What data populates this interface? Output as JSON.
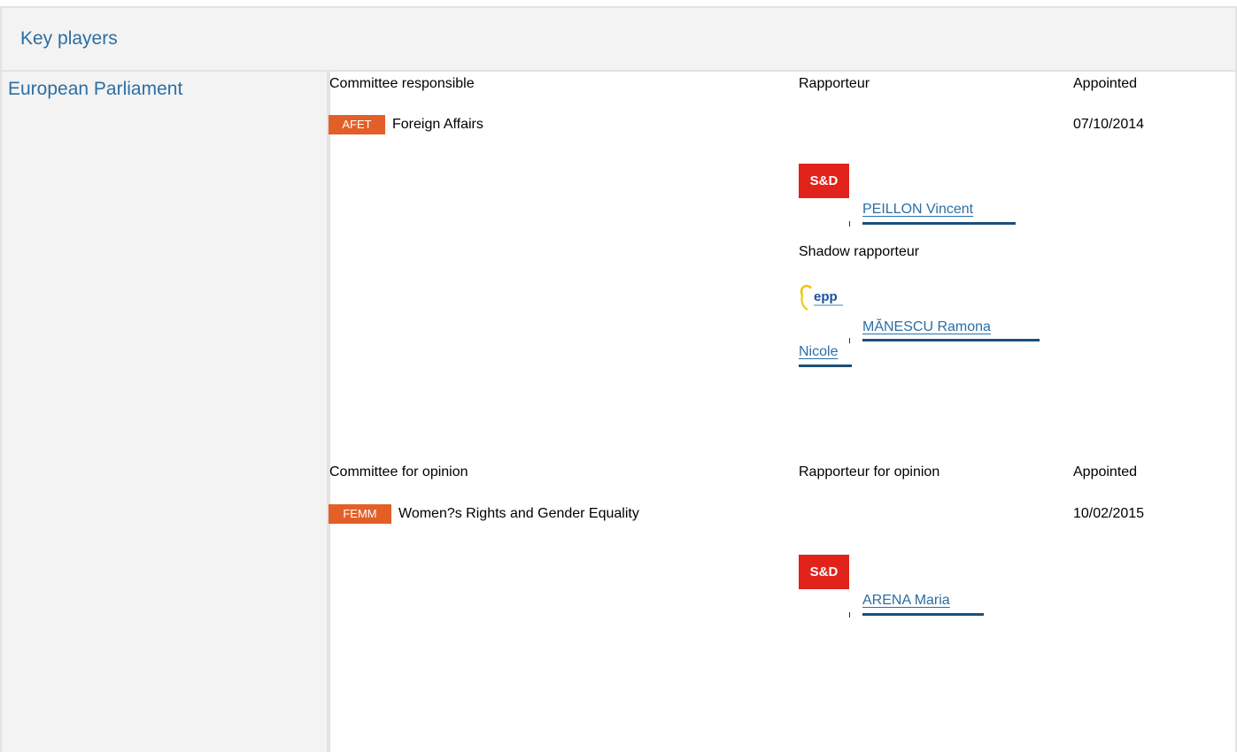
{
  "panel": {
    "title": "Key players"
  },
  "institution": "European Parliament",
  "responsible": {
    "col_committee": "Committee responsible",
    "col_rapporteur": "Rapporteur",
    "col_appointed": "Appointed",
    "committee_code": "AFET",
    "committee_name": "Foreign Affairs",
    "appointed_date": "07/10/2014",
    "rapporteur": {
      "group_logo": "S&D",
      "name": "PEILLON Vincent"
    },
    "shadow_label": "Shadow rapporteur",
    "shadow": {
      "group_logo": "epp",
      "name_line1": "MĂNESCU Ramona",
      "name_line2": "Nicole"
    }
  },
  "opinion": {
    "col_committee": "Committee for opinion",
    "col_rapporteur": "Rapporteur for opinion",
    "col_appointed": "Appointed",
    "committee_code": "FEMM",
    "committee_name": "Women?s Rights and Gender Equality",
    "appointed_date": "10/02/2015",
    "rapporteur": {
      "group_logo": "S&D",
      "name": "ARENA Maria"
    }
  },
  "colors": {
    "link": "#2c6ea3",
    "badge": "#e35f28",
    "sd_red": "#e1231b",
    "border": "#e3e3e3",
    "header_bg": "#f3f3f3"
  }
}
